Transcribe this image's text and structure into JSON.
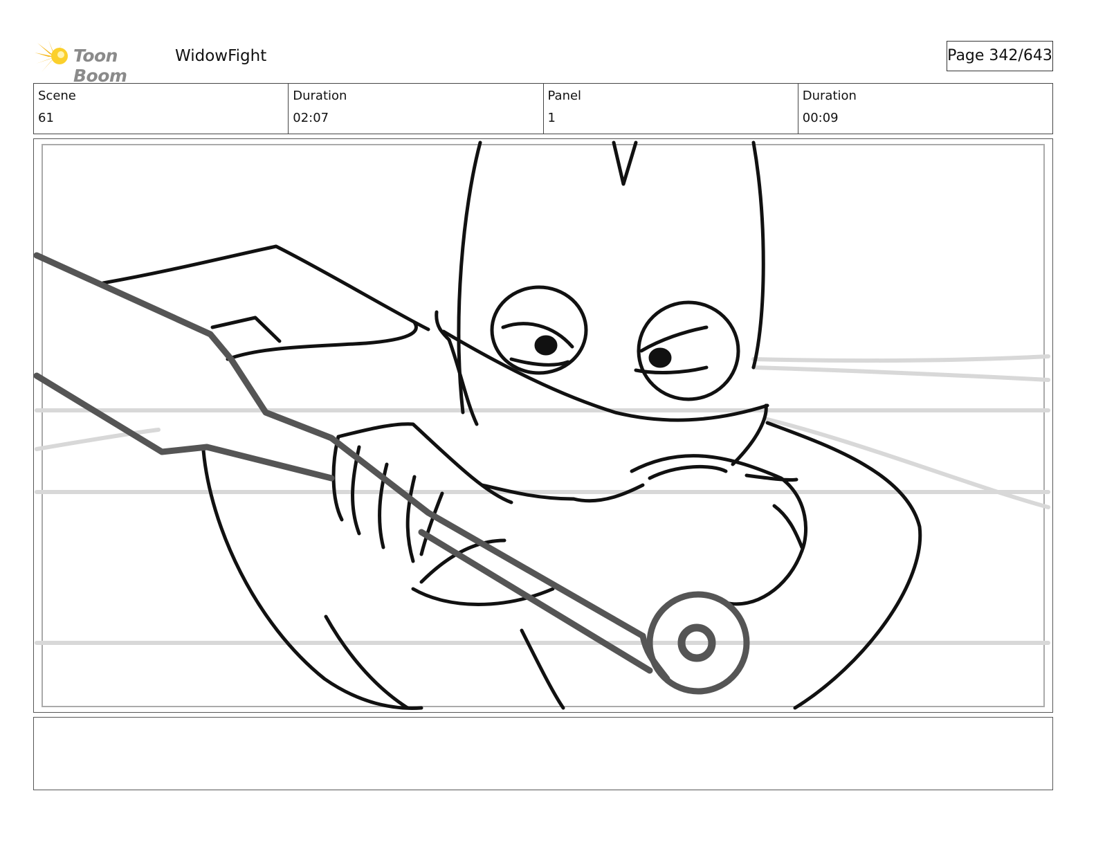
{
  "header": {
    "logo_text": "Toon Boom",
    "project_title": "WidowFight",
    "page_label": "Page 342/643"
  },
  "info": {
    "scene_label": "Scene",
    "scene_value": "61",
    "scene_duration_label": "Duration",
    "scene_duration_value": "02:07",
    "panel_label": "Panel",
    "panel_value": "1",
    "panel_duration_label": "Duration",
    "panel_duration_value": "00:09"
  },
  "caption": {
    "text": ""
  }
}
